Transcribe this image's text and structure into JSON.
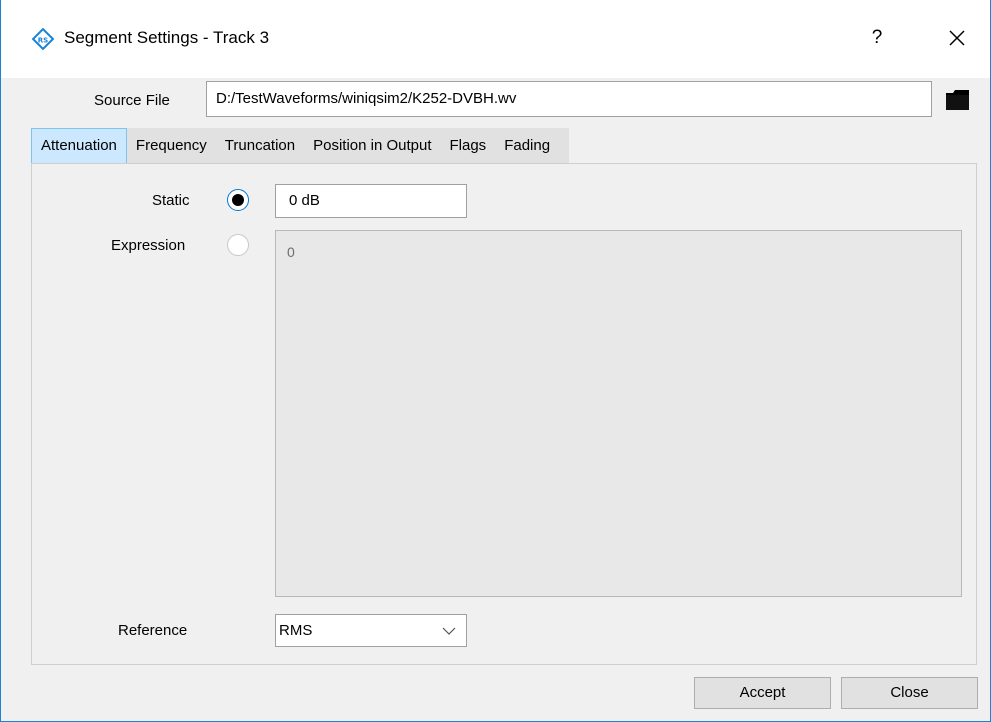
{
  "window": {
    "title": "Segment Settings - Track 3",
    "help_label": "?",
    "accent_color": "#1883d7"
  },
  "source": {
    "label": "Source File",
    "value": "D:/TestWaveforms/winiqsim2/K252-DVBH.wv"
  },
  "tabs": [
    {
      "label": "Attenuation",
      "active": true
    },
    {
      "label": "Frequency",
      "active": false
    },
    {
      "label": "Truncation",
      "active": false
    },
    {
      "label": "Position in Output",
      "active": false
    },
    {
      "label": "Flags",
      "active": false
    },
    {
      "label": "Fading",
      "active": false
    }
  ],
  "attenuation": {
    "static_label": "Static",
    "static_selected": true,
    "static_value": "0 dB",
    "expression_label": "Expression",
    "expression_selected": false,
    "expression_value": "0",
    "reference_label": "Reference",
    "reference_value": "RMS"
  },
  "buttons": {
    "accept": "Accept",
    "close": "Close"
  },
  "icons": {
    "app": "rohde-schwarz-logo-icon",
    "close": "close-icon",
    "browse": "folder-icon",
    "dropdown": "chevron-down-icon"
  }
}
